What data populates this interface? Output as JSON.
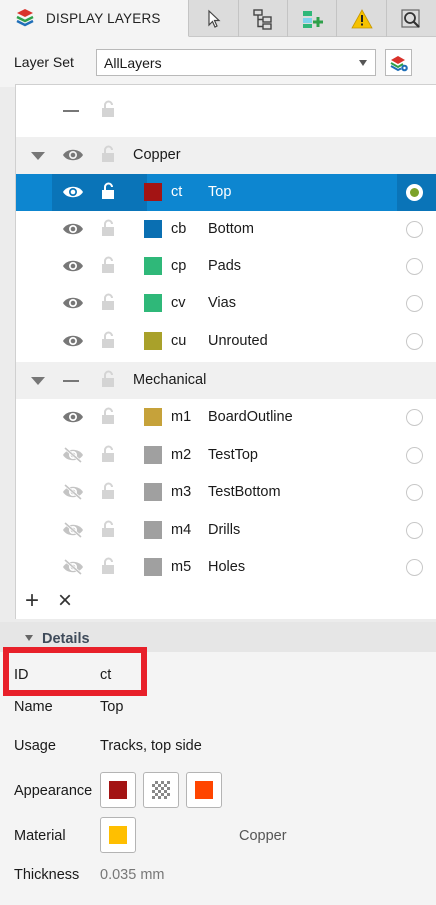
{
  "tabs": {
    "display_layers": "DISPLAY LAYERS",
    "icons": [
      "pointer-icon",
      "hierarchy-icon",
      "add-component-icon",
      "warning-icon",
      "inspect-icon"
    ]
  },
  "layer_set": {
    "label": "Layer Set",
    "value": "AllLayers"
  },
  "tree": {
    "groups": [
      {
        "name": "Copper",
        "layers": [
          {
            "code": "ct",
            "name": "Top",
            "visible": true,
            "color": "#a31414",
            "active": true
          },
          {
            "code": "cb",
            "name": "Bottom",
            "visible": true,
            "color": "#0a6fb2",
            "active": false
          },
          {
            "code": "cp",
            "name": "Pads",
            "visible": true,
            "color": "#2fb879",
            "active": false
          },
          {
            "code": "cv",
            "name": "Vias",
            "visible": true,
            "color": "#2fb879",
            "active": false
          },
          {
            "code": "cu",
            "name": "Unrouted",
            "visible": true,
            "color": "#a9a12a",
            "active": false
          }
        ]
      },
      {
        "name": "Mechanical",
        "layers": [
          {
            "code": "m1",
            "name": "BoardOutline",
            "visible": true,
            "color": "#c6a23a",
            "active": false
          },
          {
            "code": "m2",
            "name": "TestTop",
            "visible": false,
            "color": "#a0a0a0",
            "active": false
          },
          {
            "code": "m3",
            "name": "TestBottom",
            "visible": false,
            "color": "#a0a0a0",
            "active": false
          },
          {
            "code": "m4",
            "name": "Drills",
            "visible": false,
            "color": "#a0a0a0",
            "active": false
          },
          {
            "code": "m5",
            "name": "Holes",
            "visible": false,
            "color": "#a0a0a0",
            "active": false
          }
        ]
      }
    ],
    "add_label": "+",
    "remove_label": "×"
  },
  "details": {
    "title": "Details",
    "id_label": "ID",
    "id_value": "ct",
    "name_label": "Name",
    "name_value": "Top",
    "usage_label": "Usage",
    "usage_value": "Tracks, top side",
    "appearance_label": "Appearance",
    "appearance_colors": [
      "#a31414",
      "checker",
      "#ff4500"
    ],
    "material_label": "Material",
    "material_color": "#ffbf00",
    "material_name": "Copper",
    "thickness_label": "Thickness",
    "thickness_value": "0.035 mm"
  }
}
